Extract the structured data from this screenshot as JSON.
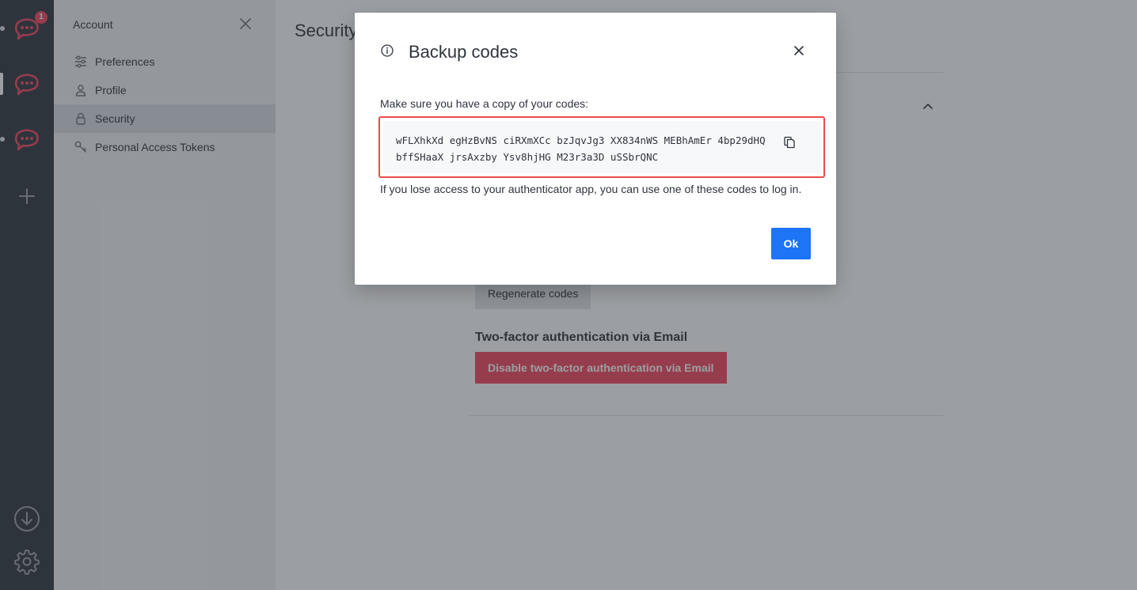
{
  "rail": {
    "unread_badge": "1"
  },
  "sidebar": {
    "title": "Account",
    "items": [
      {
        "label": "Preferences",
        "icon": "sliders-icon"
      },
      {
        "label": "Profile",
        "icon": "user-icon"
      },
      {
        "label": "Security",
        "icon": "lock-icon",
        "active": true
      },
      {
        "label": "Personal Access Tokens",
        "icon": "key-icon"
      }
    ]
  },
  "main": {
    "title": "Security",
    "regenerate_label": "Regenerate codes",
    "email_2fa_title": "Two-factor authentication via Email",
    "disable_email_2fa_label": "Disable two-factor authentication via Email"
  },
  "modal": {
    "title": "Backup codes",
    "description": "Make sure you have a copy of your codes:",
    "codes_line1": "wFLXhkXd egHzBvNS ciRXmXCc bzJqvJg3 XX834nWS MEBhAmEr 4bp29dHQ",
    "codes_line2": "bffSHaaX jrsAxzby Ysv8hjHG M23r3a3D uSSbrQNC",
    "note": "If you lose access to your authenticator app, you can use one of these codes to log in.",
    "ok_label": "Ok"
  },
  "colors": {
    "rail_bg": "#2f343d",
    "brand_red": "#f5455c",
    "primary_blue": "#1d74f5",
    "highlight_border": "#ec4c4c"
  }
}
